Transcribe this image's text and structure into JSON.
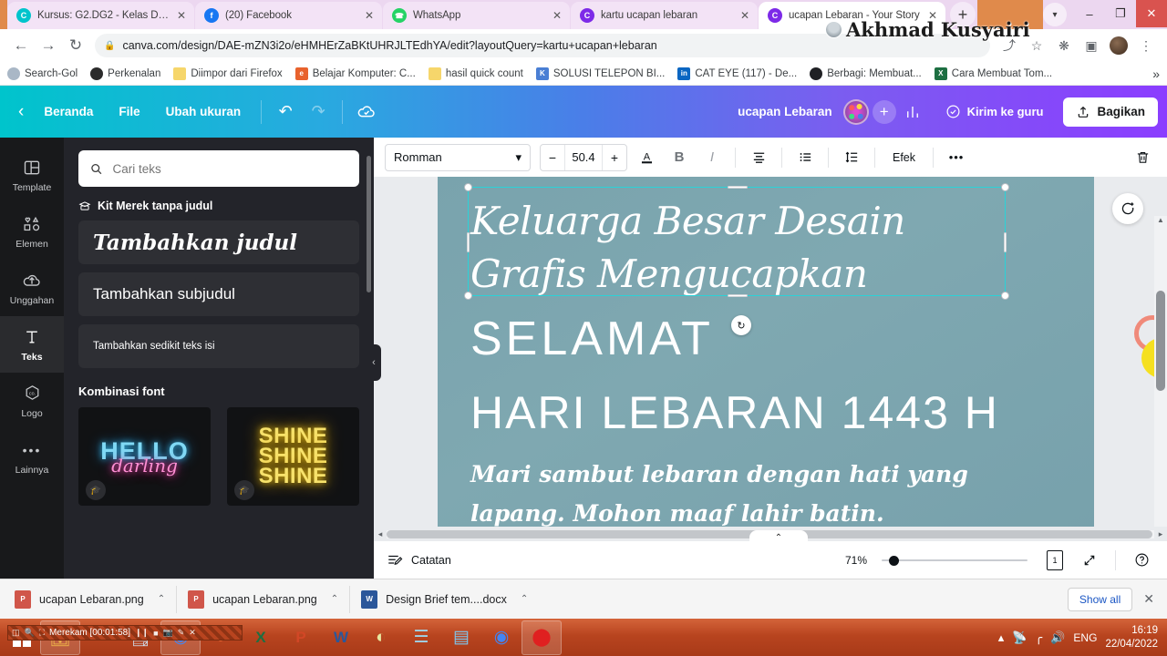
{
  "browser": {
    "tabs": [
      {
        "title": "Kursus: G2.DG2 - Kelas Desain",
        "favicon": "canva-icon",
        "active": false
      },
      {
        "title": "(20) Facebook",
        "favicon": "facebook-icon",
        "active": false
      },
      {
        "title": "WhatsApp",
        "favicon": "whatsapp-icon",
        "active": false
      },
      {
        "title": "kartu ucapan lebaran",
        "favicon": "canva-icon",
        "active": false
      },
      {
        "title": "ucapan Lebaran - Your Story",
        "favicon": "canva-icon",
        "active": true
      }
    ],
    "new_tab_label": "+",
    "window_controls": {
      "minimize": "–",
      "maximize": "❐",
      "close": "✕"
    },
    "nav": {
      "back": "←",
      "forward": "→",
      "reload": "↻",
      "lock": "🔒",
      "url": "canva.com/design/DAE-mZN3i2o/eHMHErZaBKtUHRJLTEdhYA/edit?layoutQuery=kartu+ucapan+lebaran",
      "share": "⤴",
      "bookmark_star": "☆",
      "extensions": "❖",
      "sidepanel": "▣",
      "menu": "⋮"
    },
    "bookmarks": [
      {
        "label": "Search-Gol",
        "icon": "search-icon"
      },
      {
        "label": "Perkenalan",
        "icon": "globe-icon"
      },
      {
        "label": "Diimpor dari Firefox",
        "icon": "folder-icon"
      },
      {
        "label": "Belajar Komputer: C...",
        "icon": "red-site-icon"
      },
      {
        "label": "hasil quick count",
        "icon": "folder-icon"
      },
      {
        "label": "SOLUSI TELEPON BI...",
        "icon": "blue-site-icon"
      },
      {
        "label": "CAT EYE (117) - De...",
        "icon": "linkedin-icon"
      },
      {
        "label": "Berbagi: Membuat...",
        "icon": "dark-site-icon"
      },
      {
        "label": "Cara Membuat Tom...",
        "icon": "sheets-icon"
      }
    ],
    "bookmarks_overflow": "»"
  },
  "watermark": {
    "text": "Akhmad Kusyairi"
  },
  "canva_header": {
    "back_icon": "‹",
    "menus": [
      "Beranda",
      "File",
      "Ubah ukuran"
    ],
    "undo_icon": "↶",
    "redo_icon": "↷",
    "cloud_saved_icon": "☁",
    "design_title": "ucapan Lebaran",
    "add_collaborator": "+",
    "insights_icon": "📊",
    "send_label": "Kirim ke guru",
    "send_icon": "✓",
    "share_label": "Bagikan",
    "share_icon": "↑"
  },
  "rail": {
    "items": [
      {
        "label": "Template",
        "icon": "template-icon",
        "active": false
      },
      {
        "label": "Elemen",
        "icon": "shapes-icon",
        "active": false
      },
      {
        "label": "Unggahan",
        "icon": "upload-cloud-icon",
        "active": false
      },
      {
        "label": "Teks",
        "icon": "text-t-icon",
        "active": true
      },
      {
        "label": "Logo",
        "icon": "logo-badge-icon",
        "active": false
      },
      {
        "label": "Lainnya",
        "icon": "ellipsis-icon",
        "active": false
      }
    ]
  },
  "text_panel": {
    "search_placeholder": "Cari teks",
    "search_value": "",
    "search_icon": "search-icon",
    "brand_kit_label": "Kit Merek tanpa judul",
    "brand_kit_icon": "brand-kit-icon",
    "buttons": [
      "Tambahkan judul",
      "Tambahkan subjudul",
      "Tambahkan sedikit teks isi"
    ],
    "font_combo_heading": "Kombinasi font",
    "combos": [
      {
        "line1": "HELLO",
        "line2": "darling"
      },
      {
        "line1": "SHINE",
        "line2": "SHINE",
        "line3": "SHINE"
      }
    ],
    "pro_badge_icon": "graduation-cap-icon",
    "collapse_icon": "‹"
  },
  "toolbar": {
    "font_name": "Romman",
    "font_caret": "⌄",
    "size_minus": "−",
    "size_value": "50.4",
    "size_plus": "+",
    "text_color_icon": "A",
    "bold_label": "B",
    "italic_label": "I",
    "align_icon": "align-center-icon",
    "list_icon": "bullet-list-icon",
    "spacing_icon": "line-spacing-icon",
    "effects_label": "Efek",
    "more_label": "•••",
    "delete_icon": "trash-icon"
  },
  "canvas": {
    "line_script": "Keluarga Besar Desain Grafis Mengucapkan",
    "line_selamat": "SELAMAT",
    "line_hari": "HARI LEBARAN 1443 H",
    "line_sub": "Mari sambut lebaran dengan hati yang lapang. Mohon maaf lahir batin.",
    "rotate_icon": "↻",
    "comment_icon": "💬"
  },
  "status_bar": {
    "notes_label": "Catatan",
    "notes_icon": "notes-icon",
    "zoom_value": "71%",
    "page_count": "1",
    "fullscreen_icon": "⤡",
    "help_icon": "?",
    "collapse_icon": "⌃",
    "scroll_left_icon": "◂",
    "scroll_right_icon": "▸"
  },
  "downloads": {
    "items": [
      {
        "name": "ucapan Lebaran.png",
        "icon": "png-file-icon"
      },
      {
        "name": "ucapan Lebaran.png",
        "icon": "png-file-icon"
      },
      {
        "name": "Design Brief tem....docx",
        "icon": "word-file-icon"
      }
    ],
    "caret": "⌃",
    "show_all": "Show all",
    "close": "✕"
  },
  "taskbar": {
    "start_label": "Start",
    "apps": [
      {
        "name": "file-explorer-icon",
        "glyph": "🗂",
        "pinned": true
      },
      {
        "name": "snipping-tool-icon",
        "glyph": "✂",
        "pinned": false
      },
      {
        "name": "calculator-icon",
        "glyph": "🗒",
        "pinned": false
      },
      {
        "name": "chrome-icon",
        "glyph": "◉",
        "pinned": true
      },
      {
        "name": "firefox-icon",
        "glyph": "●",
        "pinned": false
      },
      {
        "name": "excel-icon",
        "glyph": "X",
        "pinned": false
      },
      {
        "name": "powerpoint-icon",
        "glyph": "P",
        "pinned": false
      },
      {
        "name": "word-icon",
        "glyph": "W",
        "pinned": false
      },
      {
        "name": "paint-icon",
        "glyph": "◐",
        "pinned": false
      },
      {
        "name": "notepad-icon",
        "glyph": "☰",
        "pinned": false
      },
      {
        "name": "scanner-icon",
        "glyph": "▤",
        "pinned": false
      },
      {
        "name": "chrome-window-icon",
        "glyph": "◉",
        "pinned": false
      },
      {
        "name": "recorder-icon",
        "glyph": "⬤",
        "pinned": true
      }
    ],
    "tray": {
      "chevron": "▴",
      "network_icon": "📶",
      "signal_icon": "▂▄▆",
      "volume_icon": "🔊",
      "language": "ENG"
    },
    "clock_time": "16:19",
    "clock_date": "22/04/2022"
  },
  "recorder_overlay": {
    "label": "Merekam [00:01:58]"
  }
}
